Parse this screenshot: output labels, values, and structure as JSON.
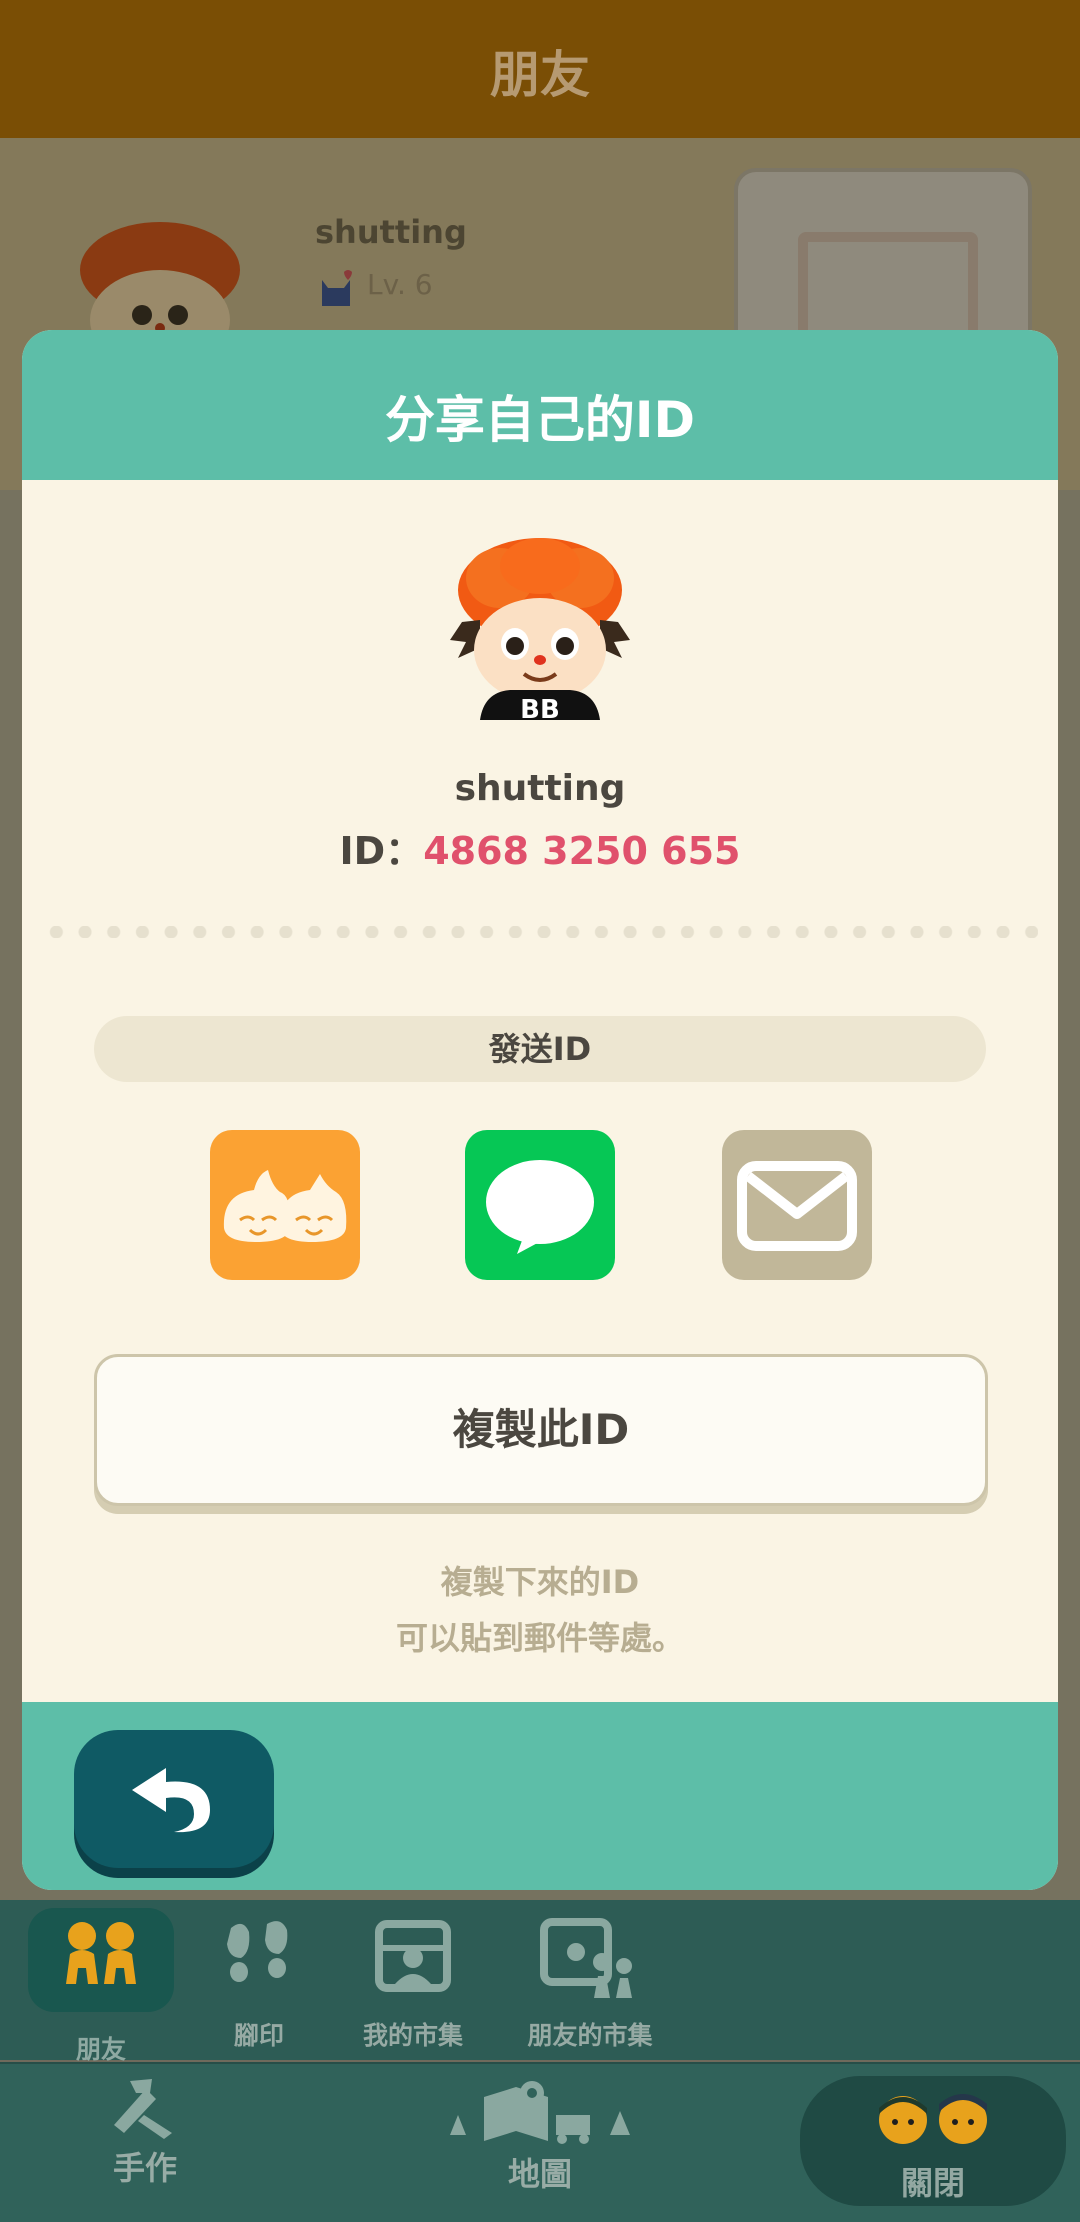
{
  "background": {
    "header_title": "朋友",
    "profile": {
      "name": "shutting",
      "level": "Lv. 6"
    }
  },
  "modal": {
    "title": "分享自己的ID",
    "username": "shutting",
    "id_label": "ID：",
    "id_value": "4868 3250 655",
    "send_label": "發送ID",
    "share_options": [
      {
        "icon": "friends-app-icon",
        "color": "#fba233"
      },
      {
        "icon": "line-chat-icon",
        "color": "#06c755"
      },
      {
        "icon": "mail-icon",
        "color": "#c1b799"
      }
    ],
    "copy_button": "複製此ID",
    "hint_line1": "複製下來的ID",
    "hint_line2": "可以貼到郵件等處。"
  },
  "nav": {
    "tabs": [
      {
        "label": "朋友",
        "icon": "friends-icon",
        "active": true
      },
      {
        "label": "腳印",
        "icon": "footprints-icon"
      },
      {
        "label": "我的市集",
        "icon": "my-market-icon"
      },
      {
        "label": "朋友的市集",
        "icon": "friends-market-icon"
      }
    ],
    "craft_label": "手作",
    "map_label": "地圖",
    "close_label": "關閉"
  },
  "colors": {
    "accent_teal": "#5dbea8",
    "id_pink": "#e0516c",
    "back_button": "#0f5a64"
  }
}
